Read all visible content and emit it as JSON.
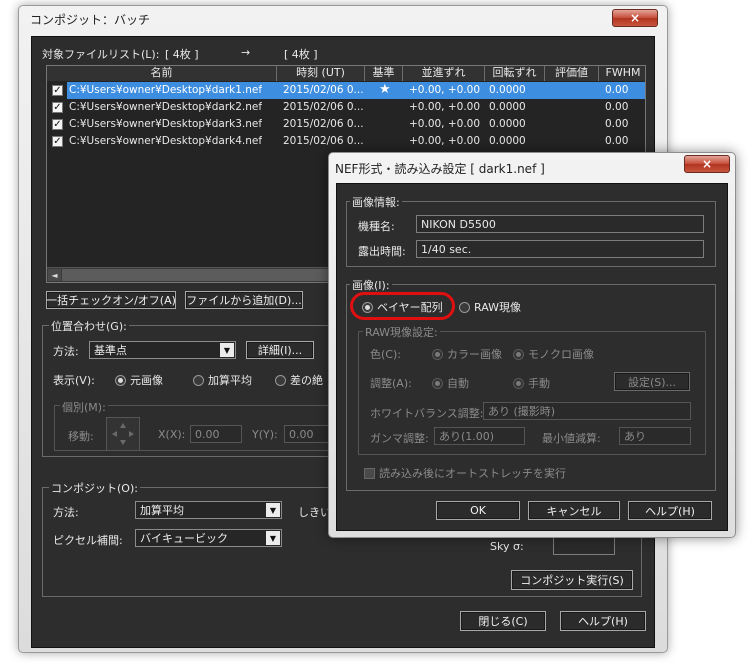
{
  "main_window": {
    "title": "コンポジット：バッチ",
    "close_icon": "×",
    "file_list_label": "対象ファイルリスト(L):",
    "count_left": "[ 4枚 ]",
    "arrow": "→",
    "count_right": "[ 4枚 ]",
    "columns": [
      "名前",
      "時刻 (UT)",
      "基準",
      "並進ずれ",
      "回転ずれ",
      "評価値",
      "FWHM"
    ],
    "rows": [
      {
        "checked": true,
        "name": "C:¥Users¥owner¥Desktop¥dark1.nef",
        "time": "2015/02/06 0...",
        "ref": "★",
        "shift": "+0.00, +0.00",
        "rot": "0.0000",
        "score": "",
        "fwhm": "0.00",
        "selected": true
      },
      {
        "checked": true,
        "name": "C:¥Users¥owner¥Desktop¥dark2.nef",
        "time": "2015/02/06 0...",
        "ref": "",
        "shift": "+0.00, +0.00",
        "rot": "0.0000",
        "score": "",
        "fwhm": "0.00",
        "selected": false
      },
      {
        "checked": true,
        "name": "C:¥Users¥owner¥Desktop¥dark3.nef",
        "time": "2015/02/06 0...",
        "ref": "",
        "shift": "+0.00, +0.00",
        "rot": "0.0000",
        "score": "",
        "fwhm": "0.00",
        "selected": false
      },
      {
        "checked": true,
        "name": "C:¥Users¥owner¥Desktop¥dark4.nef",
        "time": "2015/02/06 0...",
        "ref": "",
        "shift": "+0.00, +0.00",
        "rot": "0.0000",
        "score": "",
        "fwhm": "0.00",
        "selected": false
      }
    ],
    "scroll_left": "◄",
    "btn_check_toggle": "一括チェックオン/オフ(A)",
    "btn_add_file": "ファイルから追加(D)...",
    "align": {
      "title": "位置合わせ(G):",
      "method_label": "方法:",
      "method_value": "基準点",
      "detail_btn": "詳細(I)...",
      "display_label": "表示(V):",
      "display_options": [
        "元画像",
        "加算平均",
        "差の絶"
      ],
      "individual_title": "個別(M):",
      "move_label": "移動:",
      "x_label": "X(X):",
      "x_value": "0.00",
      "y_label": "Y(Y):",
      "y_value": "0.00"
    },
    "composite": {
      "title": "コンポジット(O):",
      "method_label": "方法:",
      "method_value": "加算平均",
      "threshold_label": "しきい",
      "interp_label": "ピクセル補間:",
      "interp_value": "バイキュービック",
      "sky_label": "Sky σ:",
      "run_btn": "コンポジット実行(S)"
    },
    "close_btn": "閉じる(C)",
    "help_btn": "ヘルプ(H)"
  },
  "nef_dialog": {
    "title": "NEF形式・読み込み設定 [ dark1.nef ]",
    "close_icon": "×",
    "info_title": "画像情報:",
    "model_label": "機種名:",
    "model_value": "NIKON D5500",
    "exposure_label": "露出時間:",
    "exposure_value": "1/40 sec.",
    "image_title": "画像(I):",
    "opt_bayer": "ベイヤー配列",
    "opt_raw": "RAW現像",
    "raw_settings_title": "RAW現像設定:",
    "color_label": "色(C):",
    "color_opt1": "カラー画像",
    "color_opt2": "モノクロ画像",
    "adjust_label": "調整(A):",
    "adjust_opt1": "自動",
    "adjust_opt2": "手動",
    "settings_btn": "設定(S)...",
    "wb_label": "ホワイトバランス調整:",
    "wb_value": "あり (撮影時)",
    "gamma_label": "ガンマ調整:",
    "gamma_value": "あり(1.00)",
    "minval_label": "最小値減算:",
    "minval_value": "あり",
    "autostretch_label": "読み込み後にオートストレッチを実行",
    "ok_btn": "OK",
    "cancel_btn": "キャンセル",
    "help_btn": "ヘルプ(H)"
  }
}
